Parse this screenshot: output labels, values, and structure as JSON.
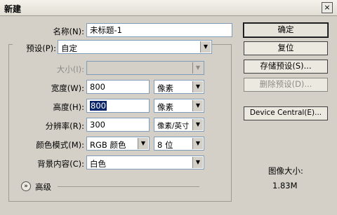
{
  "window": {
    "title": "新建",
    "close_glyph": "×"
  },
  "form": {
    "name_label": "名称(N):",
    "name_value": "未标题-1",
    "preset_label": "预设(P):",
    "preset_value": "自定",
    "size_label": "大小(I):",
    "size_value": "",
    "width_label": "宽度(W):",
    "width_value": "800",
    "width_unit": "像素",
    "height_label": "高度(H):",
    "height_value": "800",
    "height_unit": "像素",
    "resolution_label": "分辨率(R):",
    "resolution_value": "300",
    "resolution_unit": "像素/英寸",
    "color_mode_label": "颜色模式(M):",
    "color_mode_value": "RGB 颜色",
    "bit_depth_value": "8 位",
    "background_label": "背景内容(C):",
    "background_value": "白色",
    "advanced_label": "高级",
    "advanced_icon": "chevron-double-down-icon"
  },
  "buttons": {
    "ok": "确定",
    "reset": "复位",
    "save_preset": "存储预设(S)...",
    "delete_preset": "删除预设(D)...",
    "device_central": "Device Central(E)..."
  },
  "image_size": {
    "label": "图像大小:",
    "value": "1.83M"
  }
}
